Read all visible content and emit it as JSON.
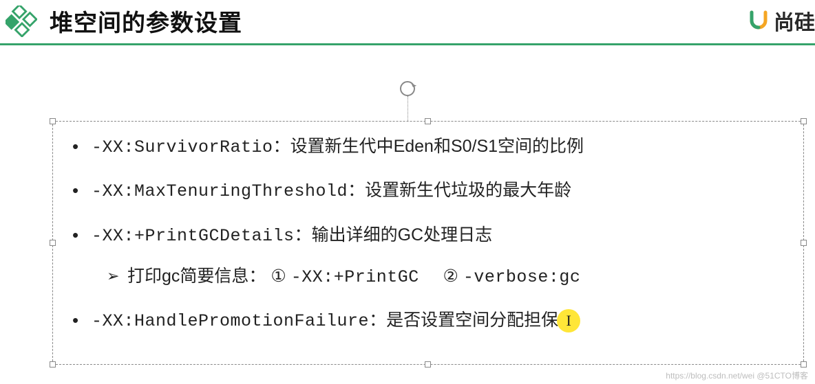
{
  "header": {
    "title": "堆空间的参数设置",
    "brand_text": "尚硅"
  },
  "bullets": [
    {
      "param": "-XX:SurvivorRatio",
      "sep": "：",
      "desc": "设置新生代中Eden和S0/S1空间的比例"
    },
    {
      "param": "-XX:MaxTenuringThreshold",
      "sep": "：",
      "desc": "设置新生代垃圾的最大年龄"
    },
    {
      "param": "-XX:+PrintGCDetails",
      "sep": "：",
      "desc": "输出详细的GC处理日志",
      "sub": {
        "marker": "➢",
        "lead": "打印gc简要信息：",
        "opt1_num": "①",
        "opt1_val": "-XX:+PrintGC",
        "opt2_num": "②",
        "opt2_val": "-verbose:gc"
      }
    },
    {
      "param": "-XX:HandlePromotionFailure",
      "sep": "：",
      "desc": "是否设置空间分配担保",
      "cursor": "I"
    }
  ],
  "watermark": "https://blog.csdn.net/wei   @51CTO博客"
}
